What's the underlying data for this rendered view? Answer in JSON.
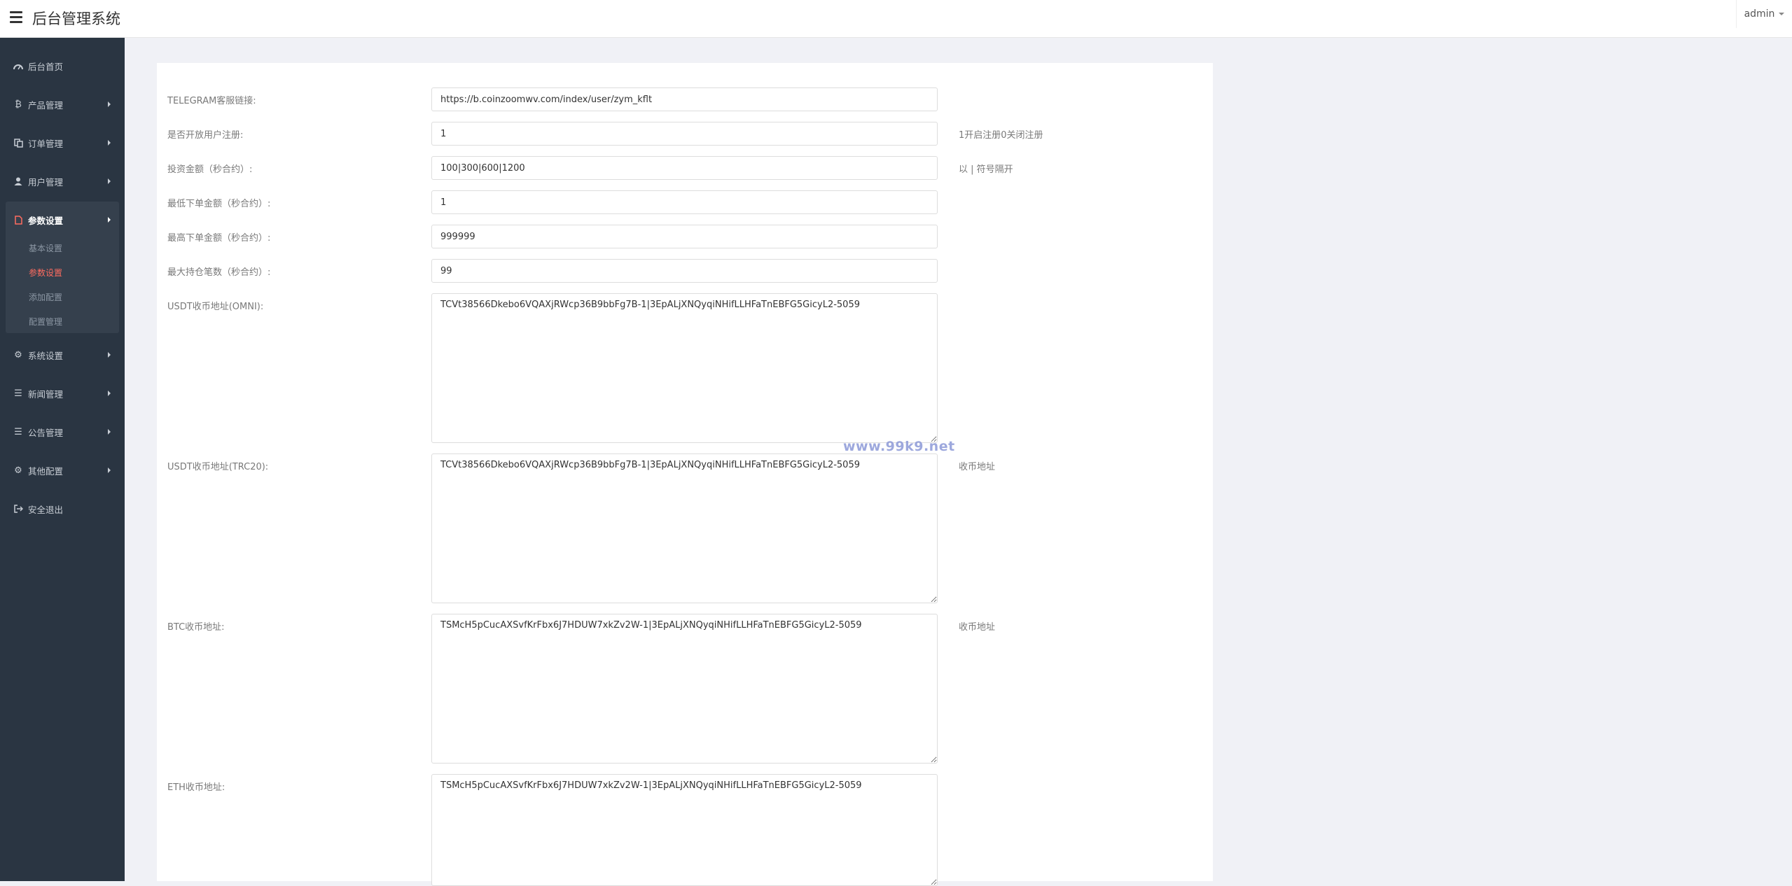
{
  "header": {
    "title": "后台管理系统",
    "user": "admin"
  },
  "sidebar": {
    "items": [
      {
        "label": "后台首页",
        "icon": "dashboard-icon"
      },
      {
        "label": "产品管理",
        "icon": "bitcoin-icon"
      },
      {
        "label": "订单管理",
        "icon": "copy-icon"
      },
      {
        "label": "用户管理",
        "icon": "user-icon"
      },
      {
        "label": "参数设置",
        "icon": "file-icon"
      },
      {
        "label": "系统设置",
        "icon": "gears-icon"
      },
      {
        "label": "新闻管理",
        "icon": "list-icon"
      },
      {
        "label": "公告管理",
        "icon": "list-icon"
      },
      {
        "label": "其他配置",
        "icon": "gear-icon"
      },
      {
        "label": "安全退出",
        "icon": "sign-out-icon"
      }
    ],
    "submenu": [
      {
        "label": "基本设置"
      },
      {
        "label": "参数设置"
      },
      {
        "label": "添加配置"
      },
      {
        "label": "配置管理"
      }
    ],
    "active_item": "参数设置",
    "active_subitem": "参数设置",
    "accent_color": "#ff6c60"
  },
  "form": {
    "fields": [
      {
        "label": "TELEGRAM客服链接:",
        "value": "https://b.coinzoomwv.com/index/user/zym_kflt",
        "help": ""
      },
      {
        "label": "是否开放用户注册:",
        "value": "1",
        "help": "1开启注册0关闭注册"
      },
      {
        "label": "投资金额（秒合约）:",
        "value": "100|300|600|1200",
        "help": "以 | 符号隔开"
      },
      {
        "label": "最低下单金额（秒合约）:",
        "value": "1",
        "help": ""
      },
      {
        "label": "最高下单金额（秒合约）:",
        "value": "999999",
        "help": ""
      },
      {
        "label": "最大持仓笔数（秒合约）:",
        "value": "99",
        "help": ""
      },
      {
        "label": "USDT收币地址(OMNI):",
        "value": "TCVt38566Dkebo6VQAXjRWcp36B9bbFg7B-1|3EpALjXNQyqiNHifLLHFaTnEBFG5GicyL2-5059",
        "help": ""
      },
      {
        "label": "USDT收币地址(TRC20):",
        "value": "TCVt38566Dkebo6VQAXjRWcp36B9bbFg7B-1|3EpALjXNQyqiNHifLLHFaTnEBFG5GicyL2-5059",
        "help": "收币地址"
      },
      {
        "label": "BTC收币地址:",
        "value": "TSMcH5pCucAXSvfKrFbx6J7HDUW7xkZv2W-1|3EpALjXNQyqiNHifLLHFaTnEBFG5GicyL2-5059",
        "help": "收币地址"
      },
      {
        "label": "ETH收币地址:",
        "value": "TSMcH5pCucAXSvfKrFbx6J7HDUW7xkZv2W-1|3EpALjXNQyqiNHifLLHFaTnEBFG5GicyL2-5059",
        "help": ""
      }
    ]
  },
  "watermark": "www.99k9.net"
}
